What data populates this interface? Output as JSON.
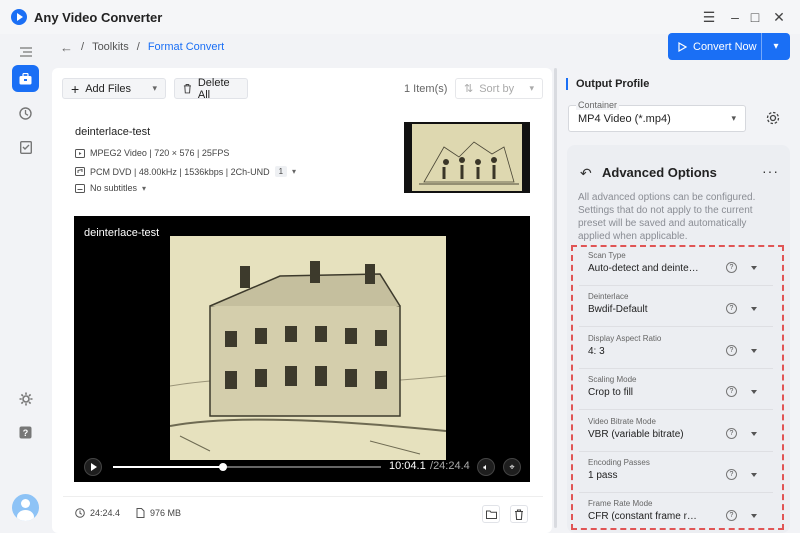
{
  "app": {
    "title": "Any Video Converter"
  },
  "window_controls": {
    "menu": "☰",
    "minimize": "–",
    "maximize": "□",
    "close": "✕"
  },
  "breadcrumb": {
    "separator": "/",
    "parent": "Toolkits",
    "current": "Format Convert"
  },
  "convert_button": {
    "label": "Convert Now"
  },
  "toolbar": {
    "add_files": "Add Files",
    "delete_all": "Delete All",
    "item_count": "1 Item(s)",
    "sort_by": "Sort by"
  },
  "file": {
    "name": "deinterlace-test",
    "video_info": "MPEG2 Video | 720 × 576 | 25FPS",
    "audio_info": "PCM DVD | 48.00kHz | 1536kbps | 2Ch-UND",
    "audio_tracks": "1",
    "subtitles": "No subtitles",
    "duration": "24:24.4",
    "size": "976 MB"
  },
  "player": {
    "title": "deinterlace-test",
    "current_time": "10:04.1",
    "separator": "/",
    "total_time": "24:24.4",
    "progress": 0.41
  },
  "output_profile": {
    "heading": "Output Profile",
    "container_label": "Container",
    "container_value": "MP4 Video (*.mp4)"
  },
  "advanced": {
    "title": "Advanced Options",
    "description": "All advanced options can be configured. Settings that do not apply to the current preset will be saved and automatically applied when applicable.",
    "options": [
      {
        "label": "Scan Type",
        "value": "Auto-detect and deinte…"
      },
      {
        "label": "Deinterlace",
        "value": "Bwdif-Default"
      },
      {
        "label": "Display Aspect Ratio",
        "value": "4: 3"
      },
      {
        "label": "Scaling Mode",
        "value": "Crop to fill"
      },
      {
        "label": "Video Bitrate Mode",
        "value": "VBR (variable bitrate)"
      },
      {
        "label": "Encoding Passes",
        "value": "1 pass"
      },
      {
        "label": "Frame Rate Mode",
        "value": "CFR (constant frame r…"
      }
    ]
  },
  "colors": {
    "accent": "#1a6ff5",
    "highlight_border": "#e05555"
  }
}
